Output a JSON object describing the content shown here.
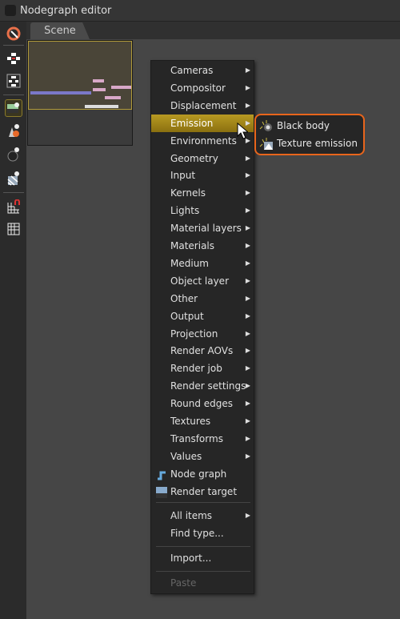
{
  "window": {
    "title": "Nodegraph editor"
  },
  "tab": {
    "label": "Scene"
  },
  "toolbar": {
    "icons": [
      "unlink-icon",
      "expand-nodes-icon",
      "collapse-nodes-icon",
      "render-target-icon",
      "geometry-icon",
      "material-icon",
      "texture-icon",
      "snap-grid-icon",
      "grid-icon"
    ],
    "active": "render-target-icon"
  },
  "menu": {
    "items": [
      {
        "label": "Cameras",
        "submenu": true
      },
      {
        "label": "Compositor",
        "submenu": true
      },
      {
        "label": "Displacement",
        "submenu": true
      },
      {
        "label": "Emission",
        "submenu": true,
        "highlighted": true
      },
      {
        "label": "Environments",
        "submenu": true
      },
      {
        "label": "Geometry",
        "submenu": true
      },
      {
        "label": "Input",
        "submenu": true
      },
      {
        "label": "Kernels",
        "submenu": true
      },
      {
        "label": "Lights",
        "submenu": true
      },
      {
        "label": "Material layers",
        "submenu": true
      },
      {
        "label": "Materials",
        "submenu": true
      },
      {
        "label": "Medium",
        "submenu": true
      },
      {
        "label": "Object layer",
        "submenu": true
      },
      {
        "label": "Other",
        "submenu": true
      },
      {
        "label": "Output",
        "submenu": true
      },
      {
        "label": "Projection",
        "submenu": true
      },
      {
        "label": "Render AOVs",
        "submenu": true
      },
      {
        "label": "Render job",
        "submenu": true
      },
      {
        "label": "Render settings",
        "submenu": true
      },
      {
        "label": "Round edges",
        "submenu": true
      },
      {
        "label": "Textures",
        "submenu": true
      },
      {
        "label": "Transforms",
        "submenu": true
      },
      {
        "label": "Values",
        "submenu": true
      },
      {
        "label": "Node graph",
        "icon": "node-graph-icon"
      },
      {
        "label": "Render target",
        "icon": "render-target-icon"
      }
    ],
    "all_items": "All items",
    "find_type": "Find type...",
    "import": "Import...",
    "paste": "Paste"
  },
  "submenu": {
    "items": [
      {
        "label": "Black body",
        "icon": "black-body-icon"
      },
      {
        "label": "Texture emission",
        "icon": "texture-emission-icon"
      }
    ],
    "highlight_color": "#e8651c"
  },
  "colors": {
    "menu_highlight": "#b89a22",
    "thumb_border": "#b09a3a"
  }
}
